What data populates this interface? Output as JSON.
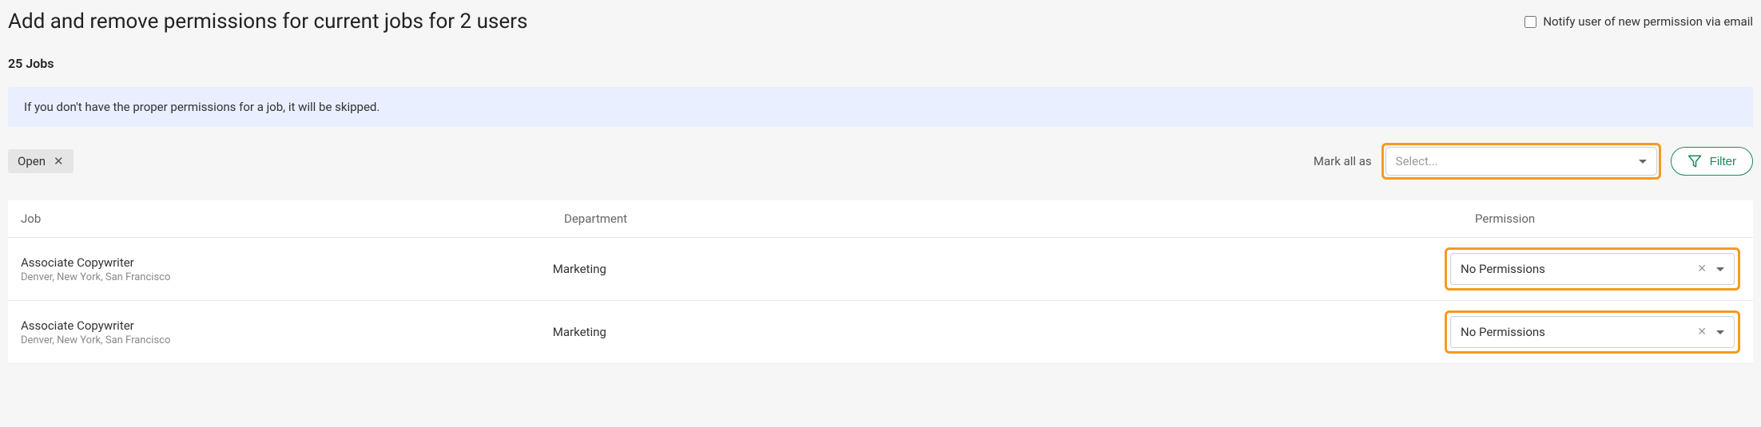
{
  "header": {
    "title": "Add and remove permissions for current jobs for 2 users",
    "notify_label": "Notify user of new permission via email"
  },
  "jobs_count": "25 Jobs",
  "info_banner": "If you don't have the proper permissions for a job, it will be skipped.",
  "filter_chip": {
    "label": "Open"
  },
  "mark_all": {
    "label": "Mark all as",
    "placeholder": "Select..."
  },
  "filter_button": "Filter",
  "table": {
    "headers": {
      "job": "Job",
      "department": "Department",
      "permission": "Permission"
    },
    "rows": [
      {
        "title": "Associate Copywriter",
        "location": "Denver, New York, San Francisco",
        "department": "Marketing",
        "permission": "No Permissions"
      },
      {
        "title": "Associate Copywriter",
        "location": "Denver, New York, San Francisco",
        "department": "Marketing",
        "permission": "No Permissions"
      }
    ]
  }
}
